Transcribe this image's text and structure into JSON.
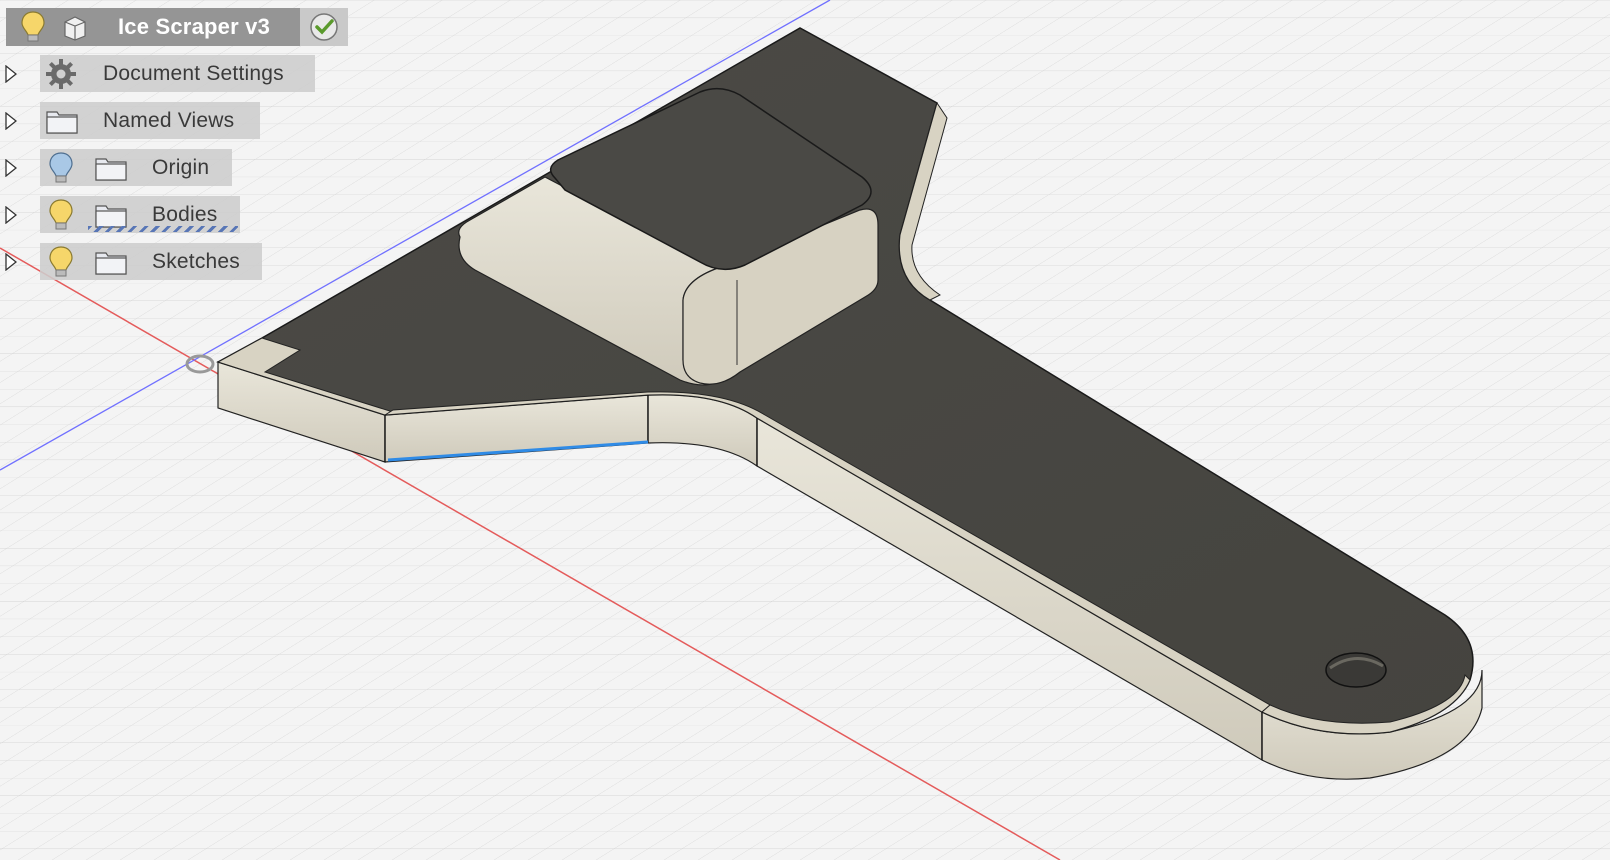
{
  "browser": {
    "root": {
      "label": "Ice Scraper v3",
      "icons": [
        "lightbulb-icon",
        "component-box-icon",
        "active-check-icon"
      ]
    },
    "items": [
      {
        "label": "Document Settings",
        "icon": "gear-icon"
      },
      {
        "label": "Named Views",
        "icon": "folder-icon"
      },
      {
        "label": "Origin",
        "icons": [
          "lightbulb-off-icon",
          "folder-icon"
        ]
      },
      {
        "label": "Bodies",
        "icons": [
          "lightbulb-icon",
          "folder-icon"
        ]
      },
      {
        "label": "Sketches",
        "icons": [
          "lightbulb-icon",
          "folder-icon"
        ]
      }
    ]
  },
  "colors": {
    "accent": "#e39b9b",
    "model_top": "#4a4945",
    "model_side": "#d9d5c7",
    "selected_edge": "#2f8be6",
    "x_axis": "#e45b5b",
    "z_axis": "#6b6bff",
    "grid": "#d6d6d6"
  }
}
